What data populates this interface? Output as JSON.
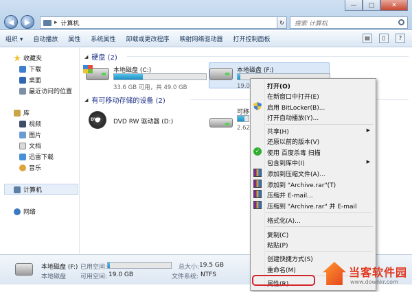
{
  "window": {
    "address_root": "计算机",
    "search_placeholder": "搜索 计算机",
    "buttons": {
      "minimize": "—",
      "maximize": "□",
      "close": "✕"
    }
  },
  "toolbar": {
    "items": [
      "组织 ▾",
      "自动播放",
      "属性",
      "系统属性",
      "卸载或更改程序",
      "映射网络驱动器",
      "打开控制面板"
    ]
  },
  "sidebar": {
    "favorites": "收藏夹",
    "favorites_items": [
      "下载",
      "桌面",
      "最近访问的位置"
    ],
    "libraries": "库",
    "library_items": [
      "视频",
      "图片",
      "文档",
      "迅雷下载",
      "音乐"
    ],
    "computer": "计算机",
    "network": "网络"
  },
  "main": {
    "hard_disks_group": "硬盘 (2)",
    "removable_group": "有可移动存储的设备 (2)",
    "drives": [
      {
        "name": "本地磁盘 (C:)",
        "free": "33.6 GB 可用，共 49.0 GB",
        "used_fraction": 0.31
      },
      {
        "name": "本地磁盘 (F:)",
        "free": "19.0",
        "used_fraction": 0.03
      }
    ],
    "dvd": {
      "name": "DVD RW 驱动器 (D:)",
      "icon_label": "DVD"
    },
    "removable": {
      "name": "可移",
      "free": "2.62"
    }
  },
  "details": {
    "name": "本地磁盘 (F:)",
    "type": "本地磁盘",
    "used_label": "已用空间:",
    "free_label": "可用空间:",
    "free_value": "19.0 GB",
    "total_label": "总大小:",
    "total_value": "19.5 GB",
    "fs_label": "文件系统:",
    "fs_value": "NTFS",
    "used_fraction": 0.03
  },
  "context_menu": {
    "items": [
      "打开(O)",
      "在新窗口中打开(E)",
      "启用 BitLocker(B)...",
      "打开自动播放(Y)...",
      "共享(H)",
      "还原以前的版本(V)",
      "使用 百度杀毒 扫描",
      "包含到库中(I)",
      "添加到压缩文件(A)...",
      "添加到 \"Archive.rar\"(T)",
      "压缩并 E-mail...",
      "压缩到 \"Archive.rar\" 并 E-mail",
      "格式化(A)...",
      "复制(C)",
      "粘贴(P)",
      "创建快捷方式(S)",
      "重命名(M)",
      "属性(R)"
    ]
  },
  "watermark": {
    "brand": "当客软件园",
    "url": "www.downkr.com"
  },
  "colors": {
    "accent": "#1e3287",
    "highlight_border": "#d4232b",
    "bar_fill": "#1d8fc4"
  }
}
